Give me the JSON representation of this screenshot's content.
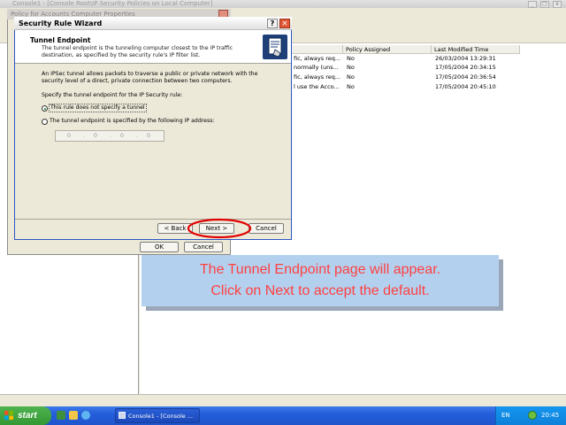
{
  "mmc": {
    "title": "Console1 - [Console Root\\IP Security Policies on Local Computer]",
    "props_title": "Policy for Accounts Computer Properties",
    "columns": [
      "Policy Assigned",
      "Last Modified Time"
    ],
    "rows": [
      {
        "desc": "fic, always req...",
        "assigned": "No",
        "modified": "26/03/2004 13:29:31"
      },
      {
        "desc": "normally (uns...",
        "assigned": "No",
        "modified": "17/05/2004 20:34:15"
      },
      {
        "desc": "fic, always req...",
        "assigned": "No",
        "modified": "17/05/2004 20:36:54"
      },
      {
        "desc": "l use the Acco...",
        "assigned": "No",
        "modified": "17/05/2004 20:45:10"
      }
    ],
    "ok_label": "OK",
    "cancel_label": "Cancel"
  },
  "wizard": {
    "title": "Security Rule Wizard",
    "help_glyph": "?",
    "close_glyph": "✕",
    "header_title": "Tunnel Endpoint",
    "header_desc": "The tunnel endpoint is the tunneling computer closest to the IP traffic destination, as specified by the security rule's IP filter list.",
    "body_desc": "An IPSec tunnel allows packets to traverse a public or private network with the security level of a direct, private connection between two computers.",
    "prompt": "Specify the tunnel endpoint for the IP Security rule:",
    "option1": "This rule does not specify a tunnel",
    "option2": "The tunnel endpoint is specified by the following IP address:",
    "ip": [
      "0",
      "0",
      "0",
      "0"
    ],
    "back_label": "< Back",
    "next_label": "Next >",
    "cancel_label": "Cancel"
  },
  "callout": {
    "line1": "The Tunnel Endpoint page will appear.",
    "line2": "Click on Next to accept the default.",
    "highlight_color": "#e00000"
  },
  "taskbar": {
    "start_label": "start",
    "task_label": "Console1 - [Console ...",
    "language": "EN",
    "clock": "20:45"
  }
}
